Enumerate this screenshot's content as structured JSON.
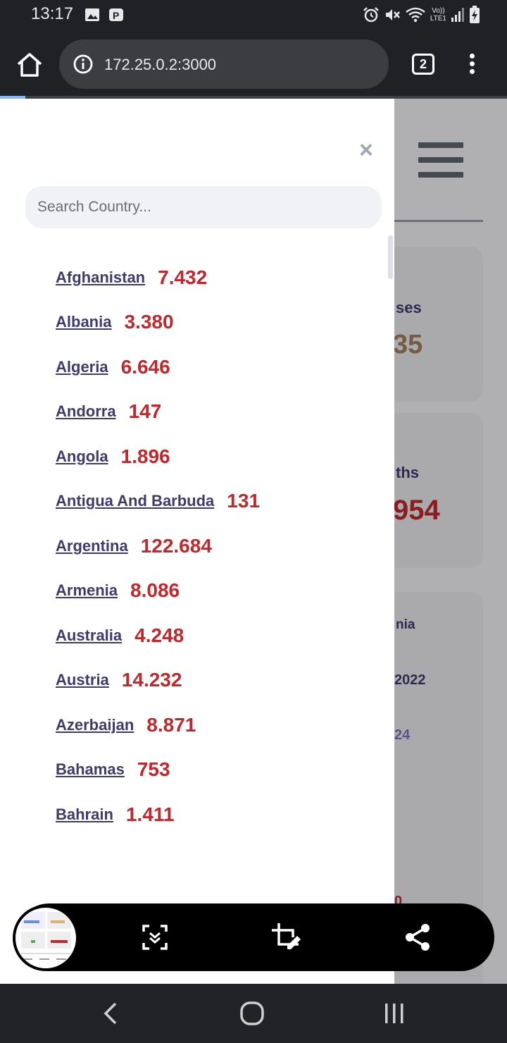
{
  "status_bar": {
    "time": "13:17",
    "network_label_top": "Vo))",
    "network_label_bottom": "LTE1"
  },
  "browser": {
    "url": "172.25.0.2:3000",
    "tab_count": "2",
    "load_progress": 0.05
  },
  "drawer": {
    "close_symbol": "×",
    "search_placeholder": "Search Country...",
    "countries": [
      {
        "name": "Afghanistan",
        "count": "7.432"
      },
      {
        "name": "Albania",
        "count": "3.380"
      },
      {
        "name": "Algeria",
        "count": "6.646"
      },
      {
        "name": "Andorra",
        "count": "147"
      },
      {
        "name": "Angola",
        "count": "1.896"
      },
      {
        "name": "Antigua And Barbuda",
        "count": "131"
      },
      {
        "name": "Argentina",
        "count": "122.684"
      },
      {
        "name": "Armenia",
        "count": "8.086"
      },
      {
        "name": "Australia",
        "count": "4.248"
      },
      {
        "name": "Austria",
        "count": "14.232"
      },
      {
        "name": "Azerbaijan",
        "count": "8.871"
      },
      {
        "name": "Bahamas",
        "count": "753"
      },
      {
        "name": "Bahrain",
        "count": "1.411"
      }
    ]
  },
  "background": {
    "card1_label": "ses",
    "card1_value": "35",
    "card2_label": "ths",
    "card2_value": "954",
    "card3_line1": "nia",
    "card3_line2": "2022",
    "card3_line3": "24",
    "card3_line4": "0"
  },
  "colors": {
    "country_link": "#3e3a6b",
    "count_red": "#c3272b",
    "card1_value": "#a38160",
    "card3_accent": "#7b74c4"
  },
  "icons": {
    "home": "home-icon",
    "info": "info-icon",
    "menu": "more-vert-icon",
    "close": "close-icon",
    "scroll_capture": "scroll-capture-icon",
    "crop_edit": "crop-edit-icon",
    "share": "share-icon",
    "nav_back": "back-icon",
    "nav_home": "home-circle-icon",
    "nav_recents": "recents-icon"
  }
}
